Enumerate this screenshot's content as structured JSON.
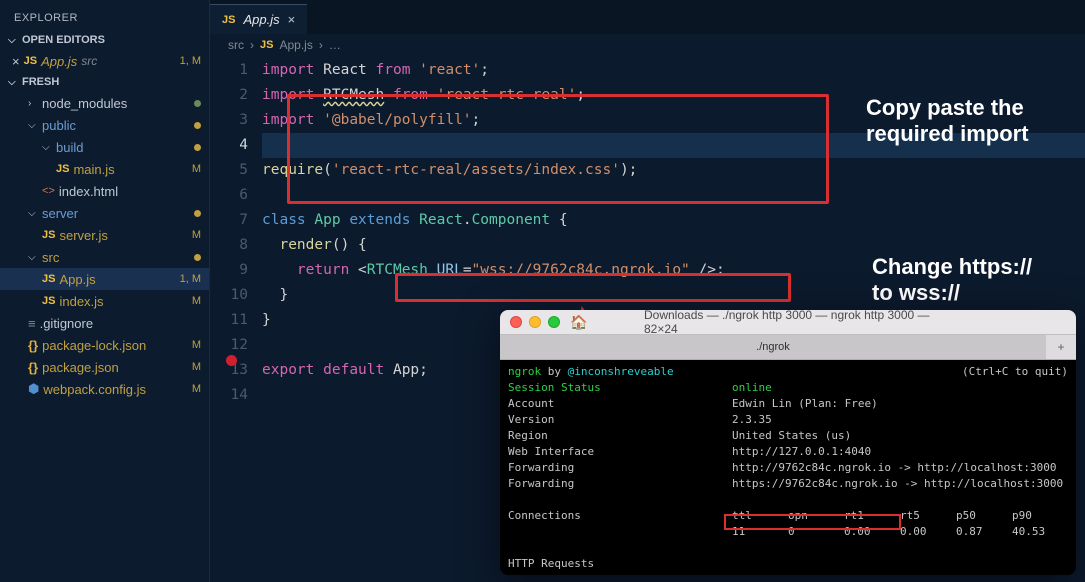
{
  "sidebar": {
    "title": "EXPLORER",
    "sections": {
      "openEditors": {
        "label": "OPEN EDITORS",
        "items": [
          {
            "icon": "JS",
            "name": "App.js",
            "path": "src",
            "status": "1, M"
          }
        ]
      },
      "workspace": {
        "label": "FRESH",
        "tree": {
          "node_modules": "node_modules",
          "public": "public",
          "build": "build",
          "main_js": "main.js",
          "index_html": "index.html",
          "server": "server",
          "server_js": "server.js",
          "src": "src",
          "app_js": "App.js",
          "index_js": "index.js",
          "gitignore": ".gitignore",
          "pkglock": "package-lock.json",
          "pkg": "package.json",
          "webpack": "webpack.config.js"
        },
        "status": {
          "main_js": "M",
          "server_js": "M",
          "app_js": "1, M",
          "index_js": "M",
          "pkglock": "M",
          "pkg": "M",
          "webpack": "M"
        }
      }
    }
  },
  "tab": {
    "icon": "JS",
    "title": "App.js"
  },
  "breadcrumbs": {
    "folder": "src",
    "file": "App.js",
    "tail": "…"
  },
  "code": {
    "l1": {
      "kw": "import",
      "id": "React",
      "kw2": "from",
      "str": "'react'",
      "t": ";"
    },
    "l2": {
      "kw": "import",
      "id": "RTCMesh",
      "kw2": "from",
      "str": "'react-rtc-real'",
      "t": ";"
    },
    "l3": {
      "kw": "import",
      "str": "'@babel/polyfill'",
      "t": ";"
    },
    "l5": {
      "fn": "require",
      "p1": "(",
      "str": "'react-rtc-real/assets/index.css'",
      "p2": ");"
    },
    "l7": {
      "kw": "class",
      "id": "App",
      "kw2": "extends",
      "sup1": "React",
      "dot": ".",
      "sup2": "Component",
      "br": " {"
    },
    "l8": {
      "fn": "render",
      "rest": "() {"
    },
    "l9": {
      "kw": "return",
      "lt": " <",
      "tag": "RTCMesh",
      "attr": " URL",
      "eq": "=",
      "str": "\"wss://9762c84c.ngrok.io\"",
      "end": " />;"
    },
    "l10": {
      "t": "}"
    },
    "l11": {
      "t": "}"
    },
    "l13": {
      "kw": "export",
      "kw2": "default",
      "id": "App",
      "t": ";"
    }
  },
  "annotations": {
    "a1l1": "Copy paste the",
    "a1l2": "required import",
    "a2l1": "Change https://",
    "a2l2": "to wss://"
  },
  "terminal": {
    "winTitle": "Downloads — ./ngrok http 3000 — ngrok http 3000 — 82×24",
    "tabTitle": "./ngrok",
    "header": {
      "app": "ngrok",
      "by": " by ",
      "author": "@inconshreveable"
    },
    "hint": "(Ctrl+C to quit)",
    "rows": {
      "sessionStatus": {
        "k": "Session Status",
        "v": "online"
      },
      "account": {
        "k": "Account",
        "v": "Edwin Lin (Plan: Free)"
      },
      "version": {
        "k": "Version",
        "v": "2.3.35"
      },
      "region": {
        "k": "Region",
        "v": "United States (us)"
      },
      "webInterface": {
        "k": "Web Interface",
        "v": "http://127.0.0.1:4040"
      },
      "fwd1": {
        "k": "Forwarding",
        "v": "http://9762c84c.ngrok.io -> http://localhost:3000"
      },
      "fwd2": {
        "k": "Forwarding",
        "v": "https://9762c84c.ngrok.io -> http://localhost:3000"
      }
    },
    "conn": {
      "label": "Connections",
      "h": {
        "ttl": "ttl",
        "opn": "opn",
        "rt1": "rt1",
        "rt5": "rt5",
        "p50": "p50",
        "p90": "p90"
      },
      "v": {
        "ttl": "11",
        "opn": "0",
        "rt1": "0.00",
        "rt5": "0.00",
        "p50": "0.87",
        "p90": "40.53"
      }
    },
    "httpReq": "HTTP Requests"
  }
}
